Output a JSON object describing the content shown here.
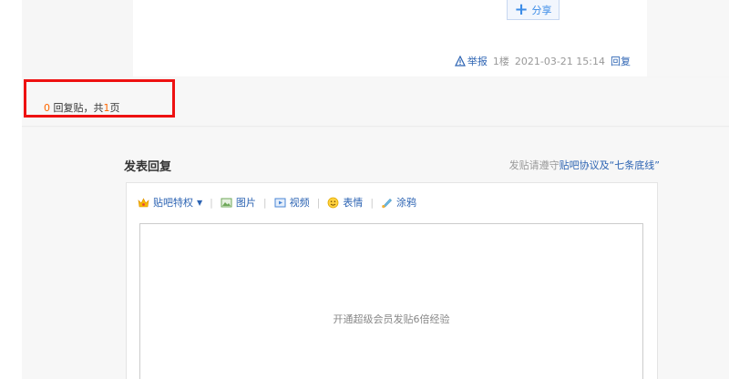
{
  "post": {
    "share_label": "分享",
    "report_label": "举报",
    "floor": "1楼",
    "timestamp": "2021-03-21 15:14",
    "reply_label": "回复"
  },
  "pager": {
    "count": "0",
    "text_mid": " 回复贴，共",
    "pages": "1",
    "text_end": "页"
  },
  "reply": {
    "title": "发表回复",
    "rules_prefix": "发贴请遵守",
    "rules_link": "贴吧协议及“七条底线”",
    "toolbar": {
      "privilege": "贴吧特权",
      "image": "图片",
      "video": "视频",
      "emoji": "表情",
      "doodle": "涂鸦"
    },
    "editor_hint": "开通超级会员发贴6倍经验"
  },
  "colors": {
    "link": "#2d64b3",
    "highlight_border": "#ee1111",
    "count_orange": "#ff6600"
  }
}
